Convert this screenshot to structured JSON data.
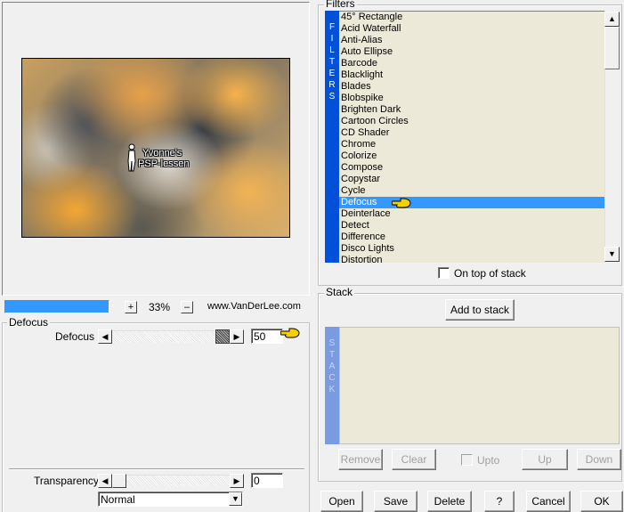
{
  "preview": {
    "watermark_line1": "Yvonne's",
    "watermark_line2": "PSP-lessen"
  },
  "zoom": {
    "plus": "+",
    "minus": "–",
    "value": "33%",
    "site": "www.VanDerLee.com"
  },
  "filter_params": {
    "group_label": "Defocus",
    "param_label": "Defocus",
    "param_value": "50"
  },
  "transparency": {
    "label": "Transparency",
    "value": "0",
    "blend_mode": "Normal"
  },
  "filters": {
    "group_label": "Filters",
    "side_letters": [
      "F",
      "I",
      "L",
      "T",
      "E",
      "R",
      "S"
    ],
    "items": [
      "45° Rectangle",
      "Acid Waterfall",
      "Anti-Alias",
      "Auto Ellipse",
      "Barcode",
      "Blacklight",
      "Blades",
      "Blobspike",
      "Brighten Dark",
      "Cartoon Circles",
      "CD Shader",
      "Chrome",
      "Colorize",
      "Compose",
      "Copystar",
      "Cycle",
      "Defocus",
      "Deinterlace",
      "Detect",
      "Difference",
      "Disco Lights",
      "Distortion"
    ],
    "selected_index": 16,
    "on_top_label": "On top of stack"
  },
  "stack": {
    "group_label": "Stack",
    "add_label": "Add to stack",
    "side_letters": [
      "S",
      "T",
      "A",
      "C",
      "K"
    ],
    "remove_label": "Remove",
    "clear_label": "Clear",
    "upto_label": "Upto",
    "up_label": "Up",
    "down_label": "Down"
  },
  "footer": {
    "open_label": "Open",
    "save_label": "Save",
    "delete_label": "Delete",
    "help_label": "?",
    "cancel_label": "Cancel",
    "ok_label": "OK"
  },
  "colors": {
    "accent": "#3399ff",
    "filters_strip": "#0050d8",
    "stack_strip": "#7b9be0",
    "list_bg": "#ece9d8"
  }
}
